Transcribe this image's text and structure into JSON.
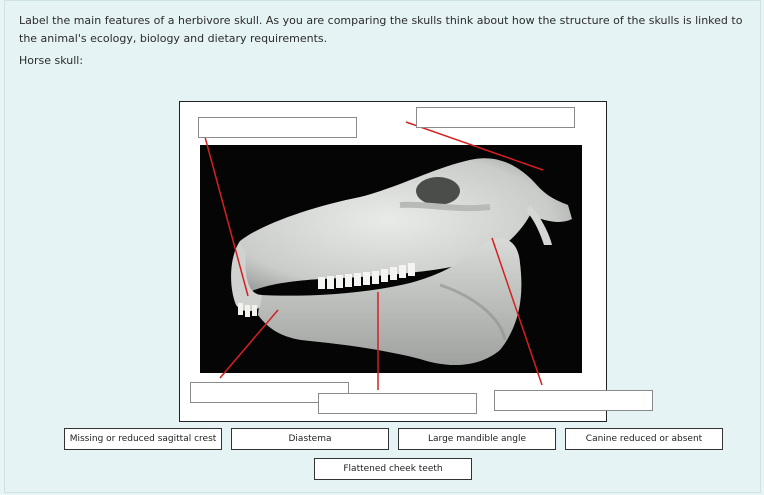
{
  "question": {
    "instructions": "Label the main features of a herbivore skull. As you are comparing the skulls think about how the structure of the skulls is linked to the animal's ecology, biology and dietary requirements.",
    "subtitle": "Horse skull:"
  },
  "answer_options": [
    {
      "label": "Missing or reduced sagittal crest"
    },
    {
      "label": "Diastema"
    },
    {
      "label": "Large mandible angle"
    },
    {
      "label": "Canine reduced or absent"
    },
    {
      "label": "Flattened cheek teeth"
    }
  ],
  "colors": {
    "background": "#e6f3f5",
    "leader_line": "#d42020",
    "photo_background": "#050505"
  }
}
